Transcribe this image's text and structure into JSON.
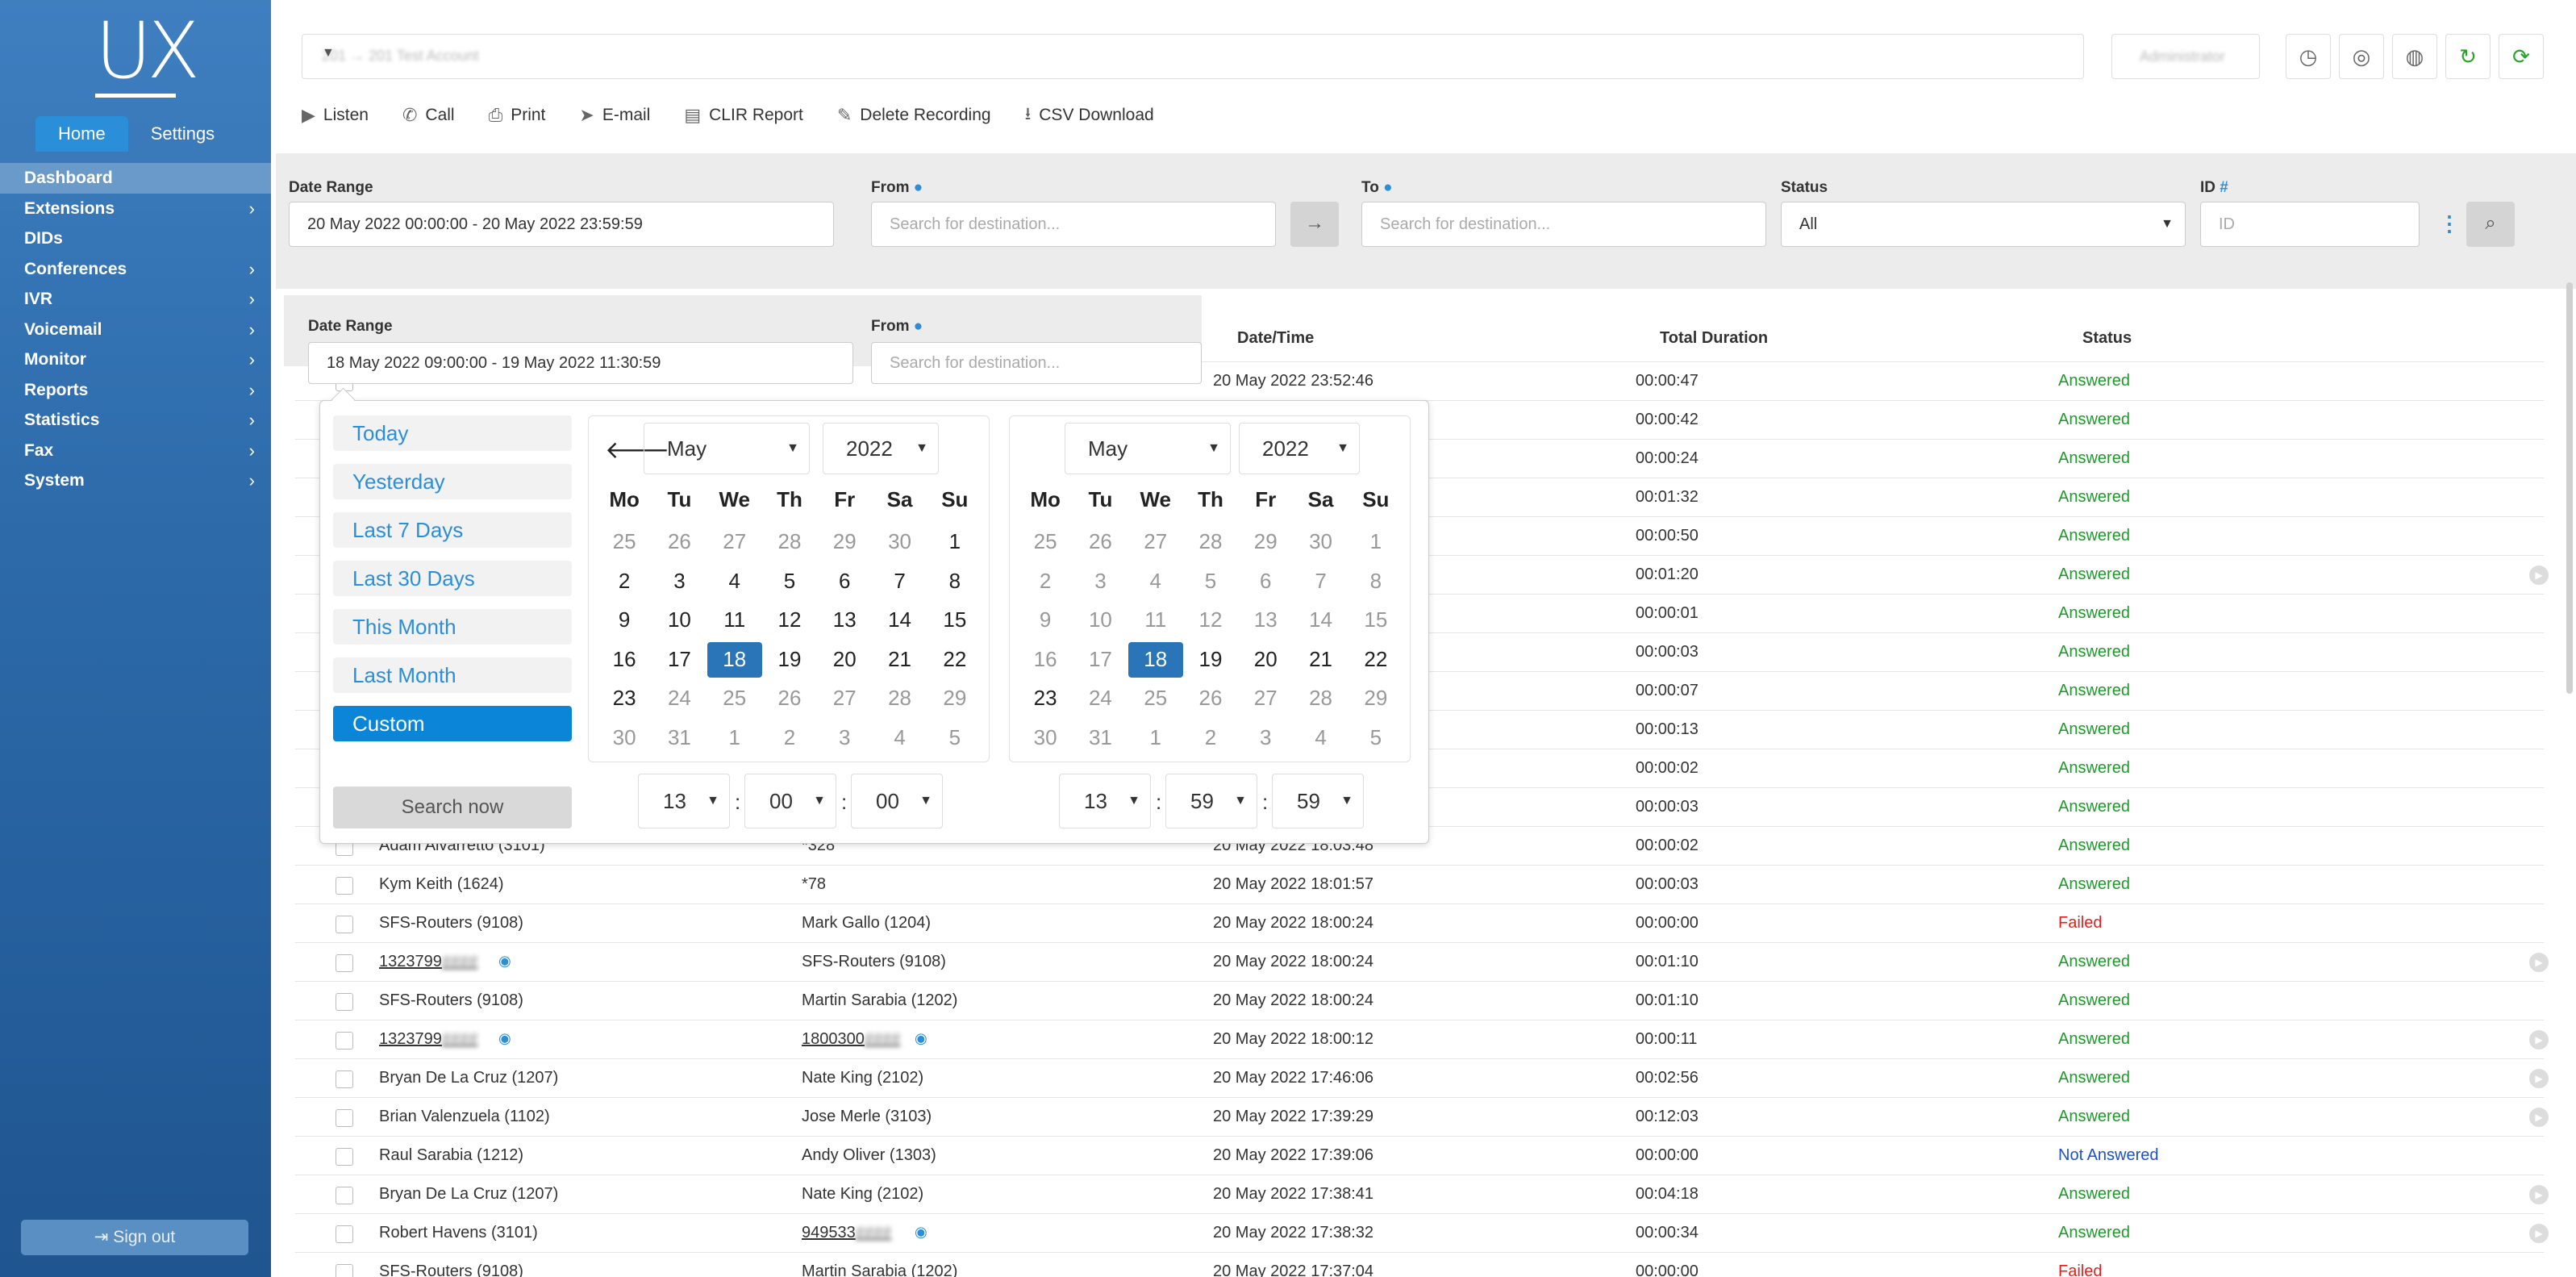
{
  "sidebar": {
    "logo": "UX",
    "tabs": [
      "Home",
      "Settings"
    ],
    "items": [
      {
        "label": "Dashboard",
        "chevron": false
      },
      {
        "label": "Extensions",
        "chevron": true
      },
      {
        "label": "DIDs",
        "chevron": false
      },
      {
        "label": "Conferences",
        "chevron": true
      },
      {
        "label": "IVR",
        "chevron": true
      },
      {
        "label": "Voicemail",
        "chevron": true
      },
      {
        "label": "Monitor",
        "chevron": true
      },
      {
        "label": "Reports",
        "chevron": true
      },
      {
        "label": "Statistics",
        "chevron": true
      },
      {
        "label": "Fax",
        "chevron": true
      },
      {
        "label": "System",
        "chevron": true
      }
    ],
    "signout": "Sign out"
  },
  "header": {
    "account": "201 → 201 Test Account",
    "user": "Administrator"
  },
  "toolbar": {
    "listen": "Listen",
    "call": "Call",
    "print": "Print",
    "email": "E-mail",
    "clir": "CLIR Report",
    "delete": "Delete Recording",
    "csv": "CSV Download"
  },
  "filter": {
    "date_label": "Date Range",
    "date_value": "20 May 2022 00:00:00 - 20 May 2022 23:59:59",
    "from_label": "From",
    "from_placeholder": "Search for destination...",
    "to_label": "To",
    "to_placeholder": "Search for destination...",
    "status_label": "Status",
    "status_value": "All",
    "id_label": "ID",
    "id_placeholder": "ID"
  },
  "popfilter": {
    "date_label": "Date Range",
    "date_value": "18 May 2022 09:00:00 - 19 May 2022 11:30:59",
    "from_label": "From",
    "from_placeholder": "Search for destination..."
  },
  "table": {
    "headers": {
      "datetime": "Date/Time",
      "duration": "Total Duration",
      "status": "Status"
    },
    "rows": [
      {
        "from": "",
        "to": "",
        "datetime": "20 May 2022 23:52:46",
        "duration": "00:00:47",
        "status": "Answered"
      },
      {
        "from": "",
        "to": "",
        "datetime": "",
        "duration": "00:00:42",
        "status": "Answered"
      },
      {
        "from": "",
        "to": "",
        "datetime": "",
        "duration": "00:00:24",
        "status": "Answered"
      },
      {
        "from": "",
        "to": "",
        "datetime": "",
        "duration": "00:01:32",
        "status": "Answered"
      },
      {
        "from": "",
        "to": "",
        "datetime": "",
        "duration": "00:00:50",
        "status": "Answered"
      },
      {
        "from": "",
        "to": "",
        "datetime": "",
        "duration": "00:01:20",
        "status": "Answered"
      },
      {
        "from": "",
        "to": "",
        "datetime": "",
        "duration": "00:00:01",
        "status": "Answered"
      },
      {
        "from": "",
        "to": "",
        "datetime": "",
        "duration": "00:00:03",
        "status": "Answered"
      },
      {
        "from": "",
        "to": "",
        "datetime": "",
        "duration": "00:00:07",
        "status": "Answered"
      },
      {
        "from": "",
        "to": "",
        "datetime": "",
        "duration": "00:00:13",
        "status": "Answered"
      },
      {
        "from": "",
        "to": "",
        "datetime": "",
        "duration": "00:00:02",
        "status": "Answered"
      },
      {
        "from": "",
        "to": "",
        "datetime": "",
        "duration": "00:00:03",
        "status": "Answered"
      },
      {
        "from": "Adam Alvarretto (3101)",
        "to": "*328",
        "datetime": "20 May 2022 18:03:48",
        "duration": "00:00:02",
        "status": "Answered"
      },
      {
        "from": "Kym Keith (1624)",
        "to": "*78",
        "datetime": "20 May 2022 18:01:57",
        "duration": "00:00:03",
        "status": "Answered"
      },
      {
        "from": "SFS-Routers (9108)",
        "to": "Mark Gallo (1204)",
        "datetime": "20 May 2022 18:00:24",
        "duration": "00:00:00",
        "status": "Failed"
      },
      {
        "from": "1323799",
        "to": "SFS-Routers (9108)",
        "datetime": "20 May 2022 18:00:24",
        "duration": "00:01:10",
        "status": "Answered"
      },
      {
        "from": "SFS-Routers (9108)",
        "to": "Martin Sarabia (1202)",
        "datetime": "20 May 2022 18:00:24",
        "duration": "00:01:10",
        "status": "Answered"
      },
      {
        "from": "1323799",
        "to": "1800300",
        "datetime": "20 May 2022 18:00:12",
        "duration": "00:00:11",
        "status": "Answered"
      },
      {
        "from": "Bryan De La Cruz (1207)",
        "to": "Nate King (2102)",
        "datetime": "20 May 2022 17:46:06",
        "duration": "00:02:56",
        "status": "Answered"
      },
      {
        "from": "Brian Valenzuela (1102)",
        "to": "Jose Merle (3103)",
        "datetime": "20 May 2022 17:39:29",
        "duration": "00:12:03",
        "status": "Answered"
      },
      {
        "from": "Raul Sarabia (1212)",
        "to": "Andy Oliver (1303)",
        "datetime": "20 May 2022 17:39:06",
        "duration": "00:00:00",
        "status": "Not Answered"
      },
      {
        "from": "Bryan De La Cruz (1207)",
        "to": "Nate King (2102)",
        "datetime": "20 May 2022 17:38:41",
        "duration": "00:04:18",
        "status": "Answered"
      },
      {
        "from": "Robert Havens (3101)",
        "to": "949533",
        "datetime": "20 May 2022 17:38:32",
        "duration": "00:00:34",
        "status": "Answered"
      },
      {
        "from": "SFS-Routers (9108)",
        "to": "Martin Sarabia (1202)",
        "datetime": "20 May 2022 17:37:04",
        "duration": "00:00:00",
        "status": "Failed"
      }
    ]
  },
  "picker": {
    "ranges": [
      "Today",
      "Yesterday",
      "Last 7 Days",
      "Last 30 Days",
      "This Month",
      "Last Month",
      "Custom"
    ],
    "active_range": "Custom",
    "search_label": "Search now",
    "dow": [
      "Mo",
      "Tu",
      "We",
      "Th",
      "Fr",
      "Sa",
      "Su"
    ],
    "left": {
      "month": "May",
      "year": "2022",
      "hour": "13",
      "minute": "00",
      "second": "00"
    },
    "right": {
      "month": "May",
      "year": "2022",
      "hour": "13",
      "minute": "59",
      "second": "59"
    },
    "selected_day": 18,
    "weeks": [
      [
        25,
        26,
        27,
        28,
        29,
        30,
        1
      ],
      [
        2,
        3,
        4,
        5,
        6,
        7,
        8
      ],
      [
        9,
        10,
        11,
        12,
        13,
        14,
        15
      ],
      [
        16,
        17,
        18,
        19,
        20,
        21,
        22
      ],
      [
        23,
        24,
        25,
        26,
        27,
        28,
        29
      ],
      [
        30,
        31,
        1,
        2,
        3,
        4,
        5
      ]
    ]
  },
  "colors": {
    "accent": "#2a8fd8",
    "answered": "#1f9a2a",
    "failed": "#e02020",
    "not_answered": "#1e50c8"
  }
}
